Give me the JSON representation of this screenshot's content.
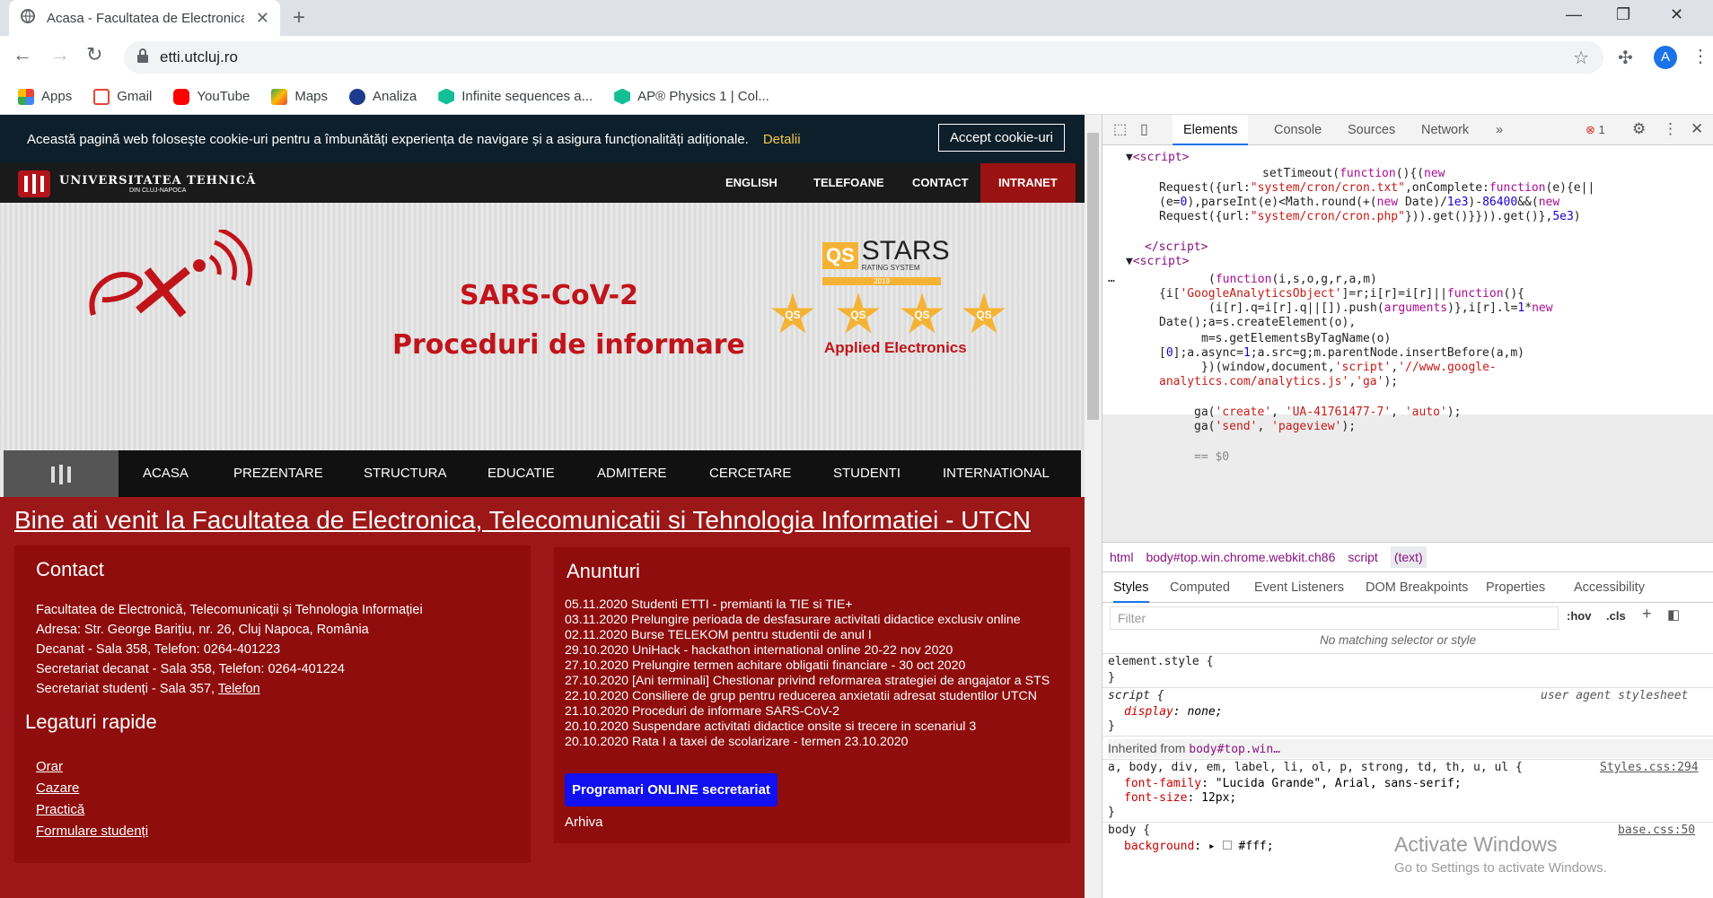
{
  "browser": {
    "tab_title": "Acasa - Facultatea de Electronica",
    "tab_close": "✕",
    "new_tab": "+",
    "url": "etti.utcluj.ro",
    "profile_initial": "A",
    "bookmarks": [
      "Apps",
      "Gmail",
      "YouTube",
      "Maps",
      "Analiza",
      "Infinite sequences a...",
      "AP® Physics 1 | Col..."
    ]
  },
  "site": {
    "cookie_text": "Această pagină web folosește cookie-uri pentru a îmbunătăți experiența de navigare și a asigura funcționalități adiționale.",
    "cookie_link": "Detalii",
    "cookie_button": "Accept cookie-uri",
    "logo_line1": "UNIVERSITATEA TEHNICĂ",
    "logo_line2": "DIN CLUJ-NAPOCA",
    "top_nav": [
      "ENGLISH",
      "TELEFOANE",
      "CONTACT",
      "INTRANET"
    ],
    "banner_line1": "SARS-CoV-2",
    "banner_line2": "Proceduri de informare",
    "qs_title": "STARS",
    "qs_subtitle": "RATING SYSTEM",
    "qs_year": "2019",
    "qs_star": "QS",
    "qs_label": "Applied Electronics",
    "main_nav": [
      "ACASA",
      "PREZENTARE",
      "STRUCTURA",
      "EDUCATIE",
      "ADMITERE",
      "CERCETARE",
      "STUDENTI",
      "INTERNATIONAL"
    ],
    "welcome": "Bine ati venit la Facultatea de Electronica, Telecomunicatii si Tehnologia Informatiei - UTCN",
    "contact_heading": "Contact",
    "contact_lines": [
      "Facultatea de Electronică, Telecomunicații și Tehnologia Informației",
      "Adresa: Str. George Barițiu, nr. 26, Cluj Napoca, România",
      "Decanat - Sala 358, Telefon: 0264-401223",
      "Secretariat decanat - Sala 358, Telefon: 0264-401224",
      "Secretariat studenți - Sala 357,"
    ],
    "contact_phone_link": "Telefon",
    "quick_heading": "Legaturi rapide",
    "quick_links": [
      "Orar",
      "Cazare",
      "Practică",
      "Formulare studenți"
    ],
    "ann_heading": "Anunturi",
    "announcements": [
      "05.11.2020 Studenti ETTI - premianti la TIE si TIE+",
      "03.11.2020 Prelungire perioada de desfasurare activitati didactice exclusiv online",
      "02.11.2020 Burse TELEKOM pentru studentii de anul I",
      "29.10.2020 UniHack - hackathon international online 20-22 nov 2020",
      "27.10.2020 Prelungire termen achitare obligatii financiare - 30 oct 2020",
      "27.10.2020 [Ani terminali] Chestionar privind reformarea strategiei de angajator a STS",
      "22.10.2020 Consiliere de grup pentru reducerea anxietatii adresat studentilor UTCN",
      "21.10.2020 Proceduri de informare SARS-CoV-2",
      "20.10.2020 Suspendare activitati didactice onsite si trecere in scenariul 3",
      "20.10.2020 Rata I a taxei de scolarizare - termen 23.10.2020"
    ],
    "prog_button": "Programari ONLINE secretariat",
    "archive": "Arhiva"
  },
  "devtools": {
    "tabs": [
      "Elements",
      "Console",
      "Sources",
      "Network",
      "»"
    ],
    "error_count": "1",
    "breadcrumbs": [
      "html",
      "body#top.win.chrome.webkit.ch86",
      "script",
      "(text)"
    ],
    "style_tabs": [
      "Styles",
      "Computed",
      "Event Listeners",
      "DOM Breakpoints",
      "Properties",
      "Accessibility"
    ],
    "filter_placeholder": "Filter",
    "hov": ":hov",
    "cls": ".cls",
    "no_match": "No matching selector or style",
    "element_style": "element.style {",
    "close_brace": "}",
    "script_selector": "script {",
    "ua_stylesheet": "user agent stylesheet",
    "display_prop": "display",
    "display_val": "none;",
    "inherited_label": "Inherited from",
    "inherited_node": "body#top.win…",
    "rule3_selector": "a, body, div, em, label, li, ol, p, strong, td, th, u, ul {",
    "rule3_source": "Styles.css:294",
    "ff_prop": "font-family",
    "ff_val": "\"Lucida Grande\", Arial, sans-serif;",
    "fs_prop": "font-size",
    "fs_val": "12px;",
    "body_selector": "body {",
    "body_source": "base.css:50",
    "bg_prop": "background",
    "bg_val": "#fff;",
    "code_dollar": "== $0",
    "activate_title": "Activate Windows",
    "activate_sub": "Go to Settings to activate Windows."
  }
}
